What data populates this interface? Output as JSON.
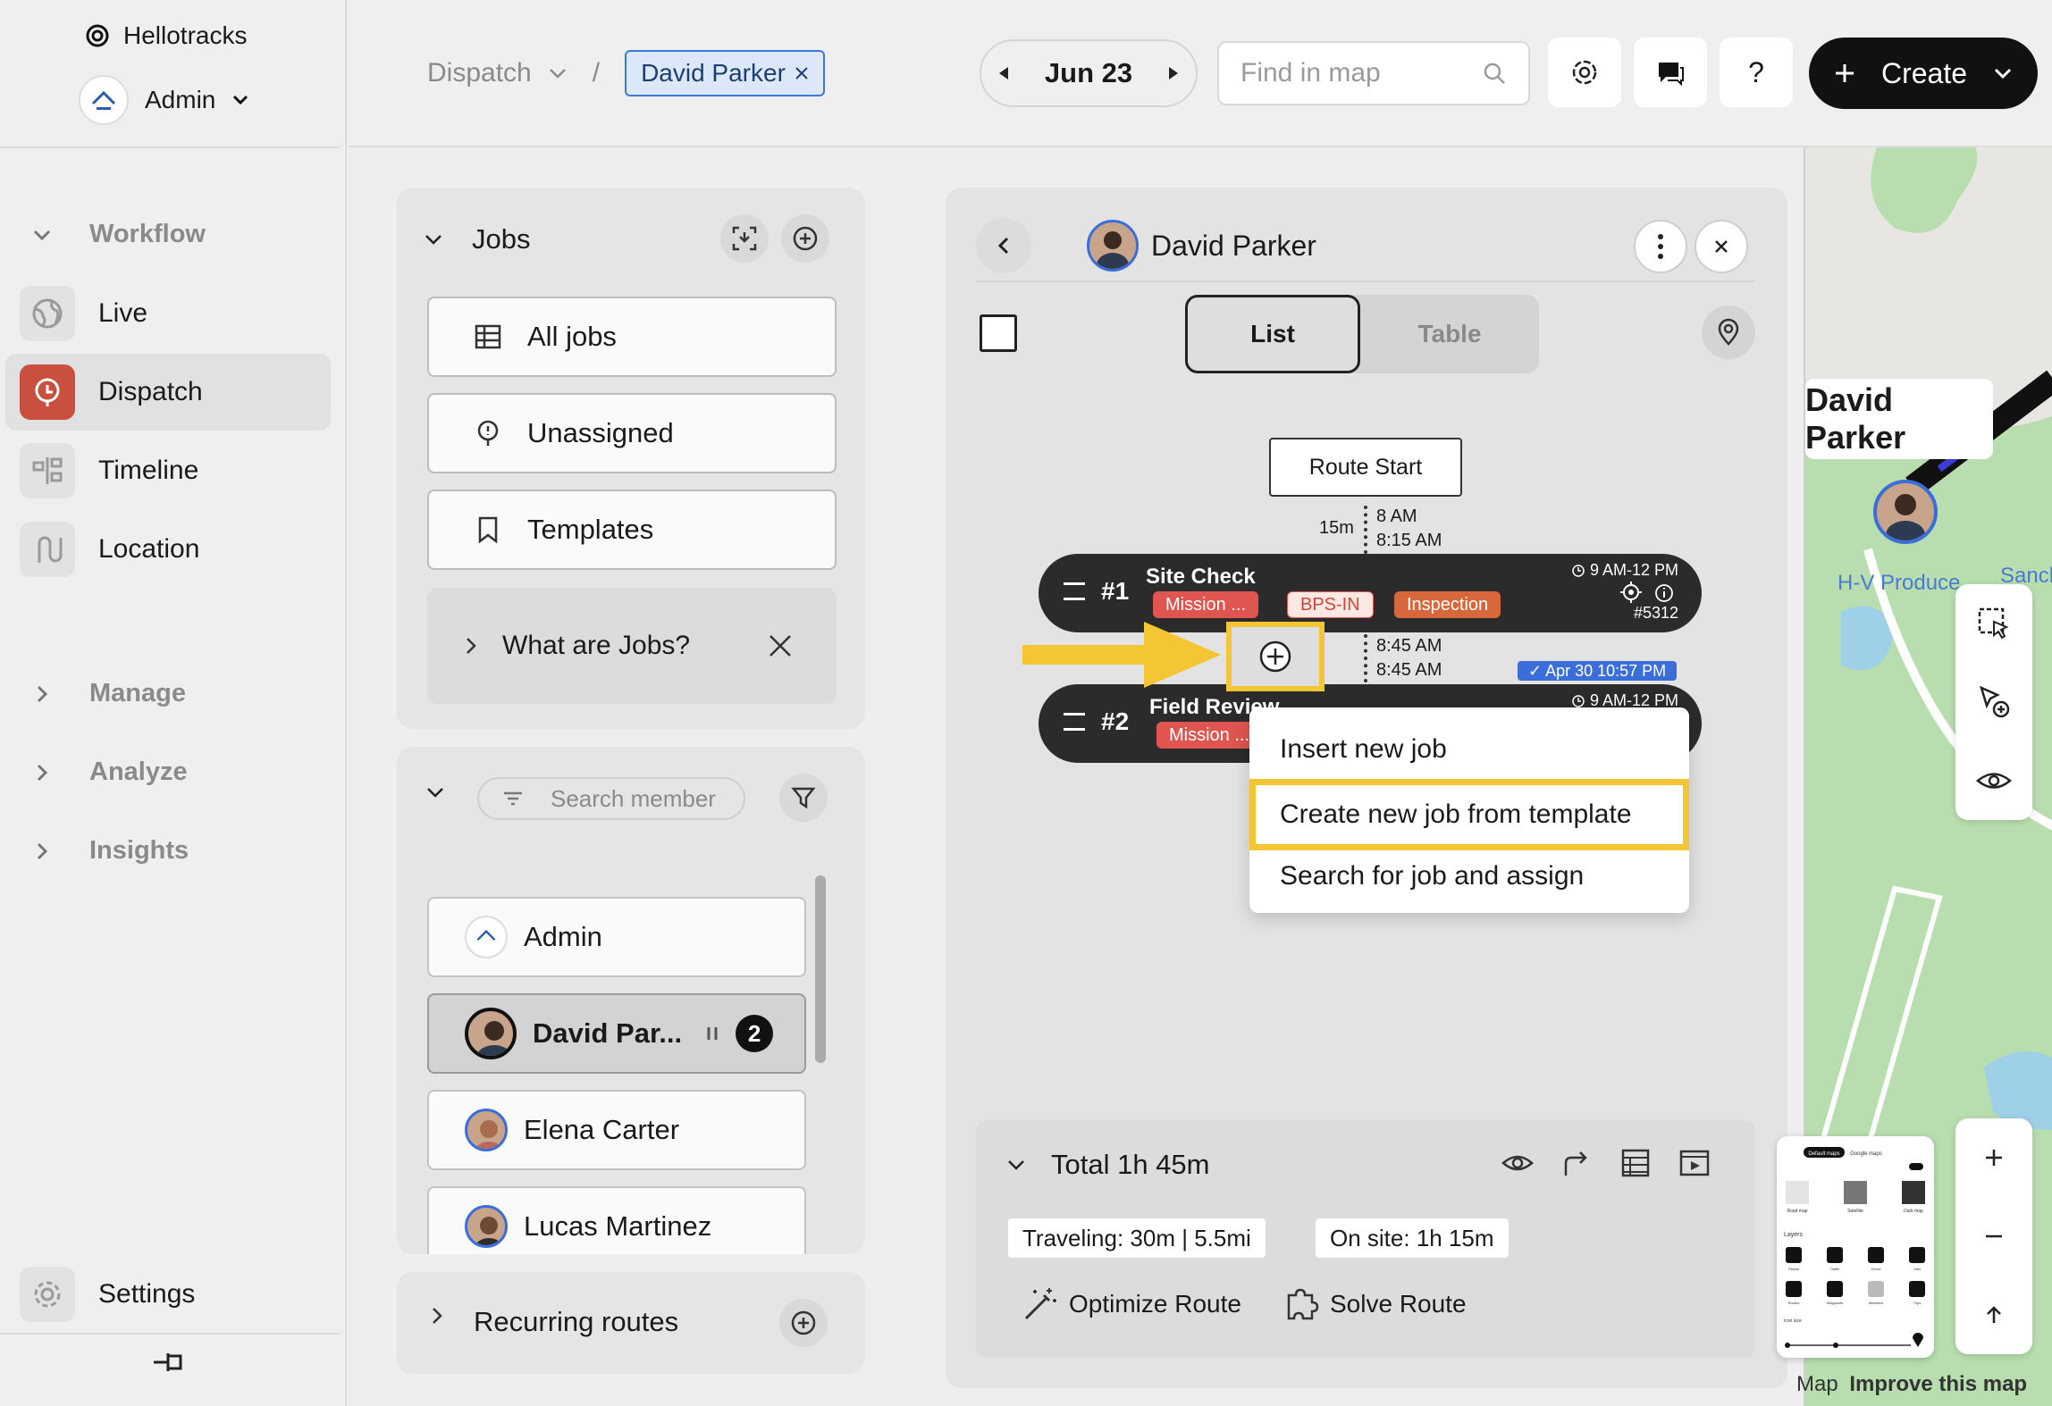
{
  "app": {
    "name": "Hellotracks",
    "user": "Admin"
  },
  "sidebar": {
    "workflow": "Workflow",
    "items": [
      {
        "label": "Live",
        "icon": "globe-icon"
      },
      {
        "label": "Dispatch",
        "icon": "dispatch-pin-icon",
        "active": true
      },
      {
        "label": "Timeline",
        "icon": "timeline-icon"
      },
      {
        "label": "Location",
        "icon": "route-icon"
      }
    ],
    "sections": [
      "Manage",
      "Analyze",
      "Insights"
    ],
    "settings": "Settings"
  },
  "topbar": {
    "breadcrumb_root": "Dispatch",
    "breadcrumb_sep": "/",
    "chip": "David Parker",
    "date": "Jun 23",
    "search_placeholder": "Find in map",
    "help": "?",
    "create": "Create"
  },
  "jobs_panel": {
    "title": "Jobs",
    "links": [
      "All jobs",
      "Unassigned",
      "Templates"
    ],
    "help": "What are Jobs?"
  },
  "members_panel": {
    "search_placeholder": "Search member",
    "members": [
      {
        "name": "Admin"
      },
      {
        "name": "David Par...",
        "active": true,
        "count": "2"
      },
      {
        "name": "Elena Carter"
      },
      {
        "name": "Lucas Martinez"
      }
    ]
  },
  "recurring": {
    "title": "Recurring routes"
  },
  "route": {
    "member": "David Parker",
    "tabs": {
      "list": "List",
      "table": "Table"
    },
    "start": "Route Start",
    "leg1": {
      "duration": "15m",
      "t1": "8 AM",
      "t2": "8:15 AM"
    },
    "leg2": {
      "t1": "8:45 AM",
      "t2": "8:45 AM"
    },
    "jobs": [
      {
        "num": "#1",
        "title": "Site Check",
        "tags": [
          "Mission ...",
          "BPS-IN",
          "Inspection"
        ],
        "time": "9 AM-12 PM",
        "id": "#5312"
      },
      {
        "num": "#2",
        "title": "Field Review",
        "tags": [
          "Mission ..."
        ],
        "time": "9 AM-12 PM"
      }
    ],
    "badge": "✓ Apr 30 10:57 PM",
    "menu": [
      "Insert new job",
      "Create new job from template",
      "Search for job and assign"
    ]
  },
  "summary": {
    "total": "Total 1h 45m",
    "traveling": "Traveling: 30m | 5.5mi",
    "onsite": "On site: 1h 15m",
    "optimize": "Optimize Route",
    "solve": "Solve Route"
  },
  "map": {
    "member_label": "David Parker",
    "place1": "H-V Produce",
    "place2": "Sanch",
    "footer_map": "Map",
    "footer_improve": "Improve this map",
    "thumb": {
      "tabs": [
        "Default maps",
        "Google maps"
      ],
      "types": [
        "Road map",
        "Satellite",
        "Dark map"
      ],
      "layers_title": "Layers",
      "layers": [
        "Places",
        "Traffic",
        "Zones",
        "Jobs",
        "Routes",
        "Waypoints",
        "Members",
        "Trips"
      ],
      "icon_size": "Icon size"
    }
  },
  "colors": {
    "accent": "#c9503f",
    "highlight": "#f4c534",
    "link_blue": "#3b6ed8"
  }
}
